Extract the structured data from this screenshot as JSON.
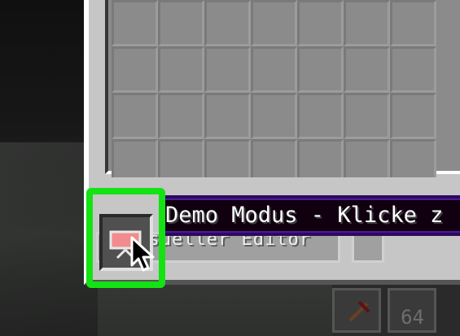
{
  "tooltip": {
    "text": "Demo Modus - Klicke z"
  },
  "visual_editor_button": {
    "label": "Visueller Editor"
  },
  "hotbar": {
    "slot2_count": "64"
  },
  "icons": {
    "mode_toggle": "presentation-board-icon",
    "cursor": "mouse-pointer-icon",
    "pickaxe": "pickaxe-icon"
  },
  "colors": {
    "highlight": "#13e313",
    "tooltip_bg": "#100010",
    "tooltip_border": "#4e1a9c",
    "panel": "#c6c6c6",
    "grid": "#8b8b8b"
  }
}
